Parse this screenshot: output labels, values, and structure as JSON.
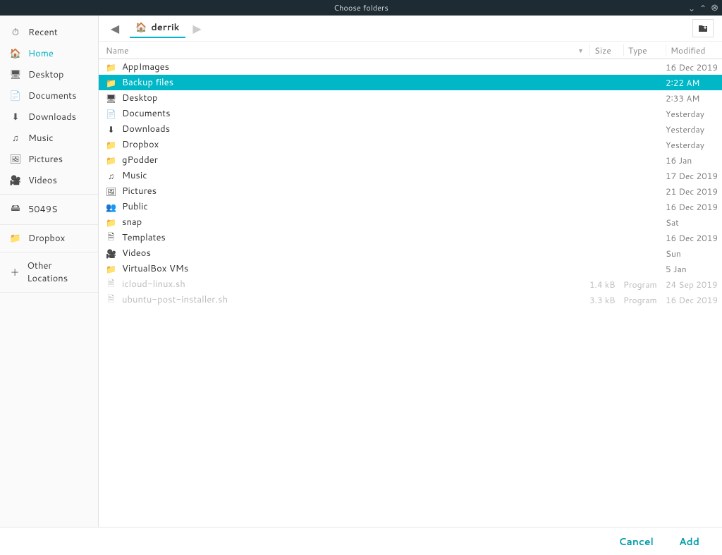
{
  "title": "Choose folders",
  "sidebar": {
    "groups": [
      [
        {
          "icon": "⏱",
          "label": "Recent",
          "active": false
        },
        {
          "icon": "🏠",
          "label": "Home",
          "active": true
        },
        {
          "icon": "🖥",
          "label": "Desktop",
          "active": false
        },
        {
          "icon": "📄",
          "label": "Documents",
          "active": false
        },
        {
          "icon": "⬇",
          "label": "Downloads",
          "active": false
        },
        {
          "icon": "♫",
          "label": "Music",
          "active": false
        },
        {
          "icon": "🖼",
          "label": "Pictures",
          "active": false
        },
        {
          "icon": "🎥",
          "label": "Videos",
          "active": false
        }
      ],
      [
        {
          "icon": "🖴",
          "label": "5049S",
          "active": false
        }
      ],
      [
        {
          "icon": "📁",
          "label": "Dropbox",
          "active": false
        }
      ],
      [
        {
          "icon": "＋",
          "label": "Other Locations",
          "active": false
        }
      ]
    ]
  },
  "breadcrumb": {
    "icon": "🏠",
    "label": "derrik"
  },
  "columns": {
    "name": "Name",
    "size": "Size",
    "type": "Type",
    "modified": "Modified"
  },
  "files": [
    {
      "icon": "📁",
      "name": "AppImages",
      "size": "",
      "type": "",
      "modified": "16 Dec 2019",
      "dim": false,
      "sel": false
    },
    {
      "icon": "📁",
      "name": "Backup files",
      "size": "",
      "type": "",
      "modified": "2∶22 AM",
      "dim": false,
      "sel": true
    },
    {
      "icon": "🖥",
      "name": "Desktop",
      "size": "",
      "type": "",
      "modified": "2∶33 AM",
      "dim": false,
      "sel": false
    },
    {
      "icon": "📄",
      "name": "Documents",
      "size": "",
      "type": "",
      "modified": "Yesterday",
      "dim": false,
      "sel": false
    },
    {
      "icon": "⬇",
      "name": "Downloads",
      "size": "",
      "type": "",
      "modified": "Yesterday",
      "dim": false,
      "sel": false
    },
    {
      "icon": "📁",
      "name": "Dropbox",
      "size": "",
      "type": "",
      "modified": "Yesterday",
      "dim": false,
      "sel": false
    },
    {
      "icon": "📁",
      "name": "gPodder",
      "size": "",
      "type": "",
      "modified": "16 Jan",
      "dim": false,
      "sel": false
    },
    {
      "icon": "♫",
      "name": "Music",
      "size": "",
      "type": "",
      "modified": "17 Dec 2019",
      "dim": false,
      "sel": false
    },
    {
      "icon": "🖼",
      "name": "Pictures",
      "size": "",
      "type": "",
      "modified": "21 Dec 2019",
      "dim": false,
      "sel": false
    },
    {
      "icon": "👥",
      "name": "Public",
      "size": "",
      "type": "",
      "modified": "16 Dec 2019",
      "dim": false,
      "sel": false
    },
    {
      "icon": "📁",
      "name": "snap",
      "size": "",
      "type": "",
      "modified": "Sat",
      "dim": false,
      "sel": false
    },
    {
      "icon": "🗎",
      "name": "Templates",
      "size": "",
      "type": "",
      "modified": "16 Dec 2019",
      "dim": false,
      "sel": false
    },
    {
      "icon": "🎥",
      "name": "Videos",
      "size": "",
      "type": "",
      "modified": "Sun",
      "dim": false,
      "sel": false
    },
    {
      "icon": "📁",
      "name": "VirtualBox VMs",
      "size": "",
      "type": "",
      "modified": "5 Jan",
      "dim": false,
      "sel": false
    },
    {
      "icon": "🗎",
      "name": "icloud-linux.sh",
      "size": "1.4 kB",
      "type": "Program",
      "modified": "24 Sep 2019",
      "dim": true,
      "sel": false
    },
    {
      "icon": "🗎",
      "name": "ubuntu-post-installer.sh",
      "size": "3.3 kB",
      "type": "Program",
      "modified": "16 Dec 2019",
      "dim": true,
      "sel": false
    }
  ],
  "footer": {
    "cancel": "Cancel",
    "add": "Add"
  }
}
